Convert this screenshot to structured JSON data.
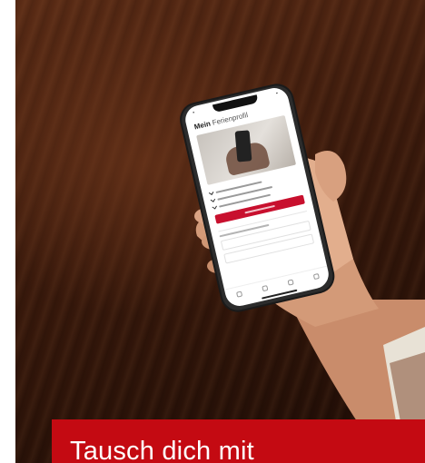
{
  "banner": {
    "text": "Tausch dich mit",
    "background": "#c40a12",
    "text_color": "#ffffff"
  },
  "photo": {
    "phone_screen": {
      "title_bold": "Mein",
      "title_rest": "Ferienprofil",
      "button_color": "#c8102e"
    }
  }
}
